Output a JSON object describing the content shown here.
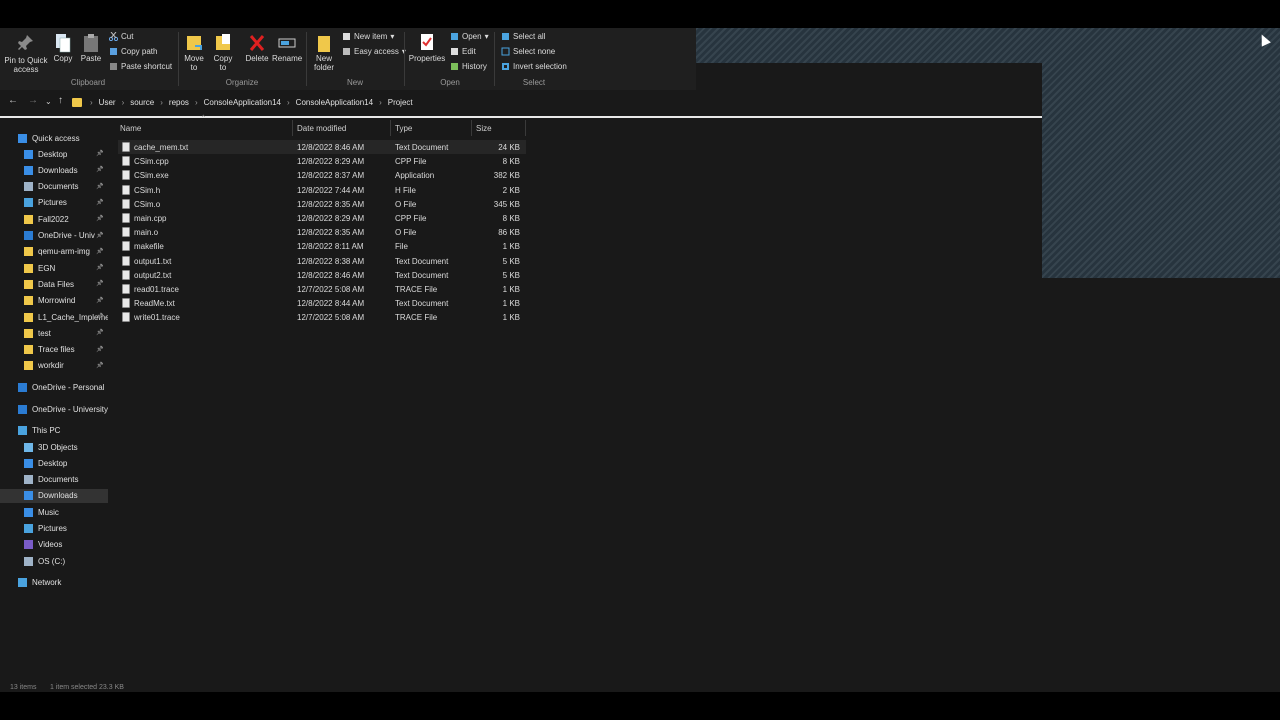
{
  "ribbon": {
    "clipboard": {
      "pin_label": "Pin to Quick access",
      "copy_label": "Copy",
      "paste_label": "Paste",
      "cut_label": "Cut",
      "copy_path_label": "Copy path",
      "paste_shortcut_label": "Paste shortcut",
      "group_label": "Clipboard"
    },
    "organize": {
      "move_to_label": "Move to",
      "copy_to_label": "Copy to",
      "delete_label": "Delete",
      "rename_label": "Rename",
      "group_label": "Organize"
    },
    "new": {
      "new_folder_label": "New folder",
      "new_item_label": "New item",
      "easy_access_label": "Easy access",
      "group_label": "New"
    },
    "open": {
      "properties_label": "Properties",
      "open_label": "Open",
      "edit_label": "Edit",
      "history_label": "History",
      "group_label": "Open"
    },
    "select": {
      "select_all_label": "Select all",
      "select_none_label": "Select none",
      "invert_label": "Invert selection",
      "group_label": "Select"
    }
  },
  "breadcrumb": [
    "User",
    "source",
    "repos",
    "ConsoleApplication14",
    "ConsoleApplication14",
    "Project"
  ],
  "nav": {
    "quick_access": "Quick access",
    "quick_items": [
      {
        "label": "Desktop",
        "color": "#3a8ee6"
      },
      {
        "label": "Downloads",
        "color": "#3a8ee6"
      },
      {
        "label": "Documents",
        "color": "#9fb3c8"
      },
      {
        "label": "Pictures",
        "color": "#4aa3df"
      },
      {
        "label": "Fall2022",
        "color": "#f0c84a"
      },
      {
        "label": "OneDrive - Univ",
        "color": "#2b7cd3"
      },
      {
        "label": "qemu-arm-img",
        "color": "#f0c84a"
      },
      {
        "label": "EGN",
        "color": "#f0c84a"
      },
      {
        "label": "Data Files",
        "color": "#f0c84a"
      },
      {
        "label": "Morrowind",
        "color": "#f0c84a"
      },
      {
        "label": "L1_Cache_Impleme",
        "color": "#f0c84a"
      },
      {
        "label": "test",
        "color": "#f0c84a"
      },
      {
        "label": "Trace files",
        "color": "#f0c84a"
      },
      {
        "label": "workdir",
        "color": "#f0c84a"
      }
    ],
    "onedrive_personal": "OneDrive - Personal",
    "onedrive_university": "OneDrive - University",
    "this_pc": "This PC",
    "pc_items": [
      {
        "label": "3D Objects",
        "color": "#6fb7e8"
      },
      {
        "label": "Desktop",
        "color": "#3a8ee6"
      },
      {
        "label": "Documents",
        "color": "#9fb3c8"
      },
      {
        "label": "Downloads",
        "color": "#3a8ee6"
      },
      {
        "label": "Music",
        "color": "#3a8ee6"
      },
      {
        "label": "Pictures",
        "color": "#4aa3df"
      },
      {
        "label": "Videos",
        "color": "#7a5cc8"
      },
      {
        "label": "OS (C:)",
        "color": "#9fb3c8"
      }
    ],
    "network": "Network"
  },
  "columns": {
    "name": "Name",
    "date": "Date modified",
    "type": "Type",
    "size": "Size"
  },
  "files": [
    {
      "name": "cache_mem.txt",
      "date": "12/8/2022 8:46 AM",
      "type": "Text Document",
      "size": "24 KB"
    },
    {
      "name": "CSim.cpp",
      "date": "12/8/2022 8:29 AM",
      "type": "CPP File",
      "size": "8 KB"
    },
    {
      "name": "CSim.exe",
      "date": "12/8/2022 8:37 AM",
      "type": "Application",
      "size": "382 KB"
    },
    {
      "name": "CSim.h",
      "date": "12/8/2022 7:44 AM",
      "type": "H File",
      "size": "2 KB"
    },
    {
      "name": "CSim.o",
      "date": "12/8/2022 8:35 AM",
      "type": "O File",
      "size": "345 KB"
    },
    {
      "name": "main.cpp",
      "date": "12/8/2022 8:29 AM",
      "type": "CPP File",
      "size": "8 KB"
    },
    {
      "name": "main.o",
      "date": "12/8/2022 8:35 AM",
      "type": "O File",
      "size": "86 KB"
    },
    {
      "name": "makefile",
      "date": "12/8/2022 8:11 AM",
      "type": "File",
      "size": "1 KB"
    },
    {
      "name": "output1.txt",
      "date": "12/8/2022 8:38 AM",
      "type": "Text Document",
      "size": "5 KB"
    },
    {
      "name": "output2.txt",
      "date": "12/8/2022 8:46 AM",
      "type": "Text Document",
      "size": "5 KB"
    },
    {
      "name": "read01.trace",
      "date": "12/7/2022 5:08 AM",
      "type": "TRACE File",
      "size": "1 KB"
    },
    {
      "name": "ReadMe.txt",
      "date": "12/8/2022 8:44 AM",
      "type": "Text Document",
      "size": "1 KB"
    },
    {
      "name": "write01.trace",
      "date": "12/7/2022 5:08 AM",
      "type": "TRACE File",
      "size": "1 KB"
    }
  ],
  "status": {
    "count": "13 items",
    "selected": "1 item selected  23.3 KB"
  }
}
